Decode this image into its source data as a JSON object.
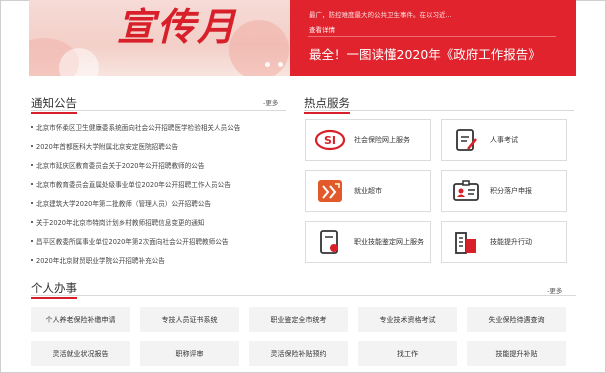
{
  "banner": {
    "image_title": "宣传月",
    "carousel_dots": 5,
    "active_dot": 4,
    "news_summary": "最广，防控难度最大的公共卫生事件。在以习近...",
    "news_more": "查看详情",
    "news_headline": "最全！一图读懂2020年《政府工作报告》"
  },
  "notices": {
    "title": "通知公告",
    "more": "更多",
    "items": [
      "北京市怀柔区卫生健康委系统面向社会公开招聘医学检验相关人员公告",
      "2020年首都医科大学附属北京安定医院招聘公告",
      "北京市延庆区教育委员会关于2020年公开招聘教师的公告",
      "北京市教育委员会直属处级事业单位2020年公开招聘工作人员公告",
      "北京建筑大学2020年第二批教师（管理人员）公开招聘公告",
      "关于2020年北京市特岗计划乡村教师招聘信息变更的通知",
      "昌平区教委所属事业单位2020年第2次面向社会公开招聘教师公告",
      "2020年北京财贸职业学院公开招聘补充公告"
    ]
  },
  "services": {
    "title": "热点服务",
    "items": [
      {
        "label": "社会保险网上服务",
        "icon": "social-insurance-icon"
      },
      {
        "label": "人事考试",
        "icon": "exam-icon"
      },
      {
        "label": "就业超市",
        "icon": "job-market-icon"
      },
      {
        "label": "积分落户申报",
        "icon": "id-card-icon"
      },
      {
        "label": "职业技能鉴定网上服务",
        "icon": "certificate-icon"
      },
      {
        "label": "技能提升行动",
        "icon": "buildings-icon"
      }
    ]
  },
  "personal": {
    "title": "个人办事",
    "more": "更多",
    "items": [
      "个人养老保险补缴申请",
      "专技人员证书系统",
      "职业鉴定全市统考",
      "专业技术资格考试",
      "失业保险待遇查询",
      "灵活就业状况报告",
      "职称评审",
      "灵活保险补贴预约",
      "找工作",
      "技能提升补贴"
    ]
  },
  "colors": {
    "accent": "#e0232d",
    "border": "#dcdcdc",
    "button_bg": "#f3f3f3"
  }
}
